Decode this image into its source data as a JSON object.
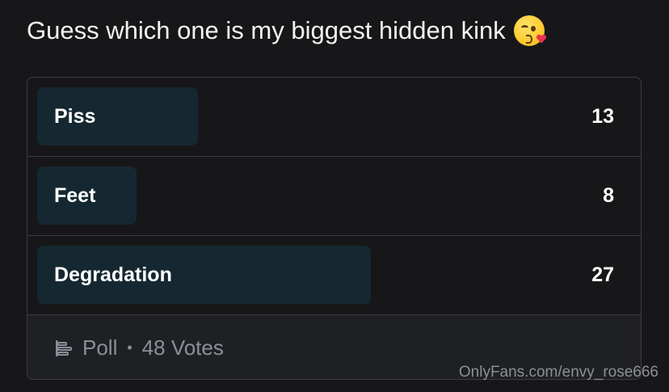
{
  "post": {
    "text": "Guess which one is my biggest hidden kink",
    "emoji_icon": "face-blowing-kiss-icon"
  },
  "poll": {
    "options": [
      {
        "label": "Piss",
        "votes": "13",
        "share": 0.271
      },
      {
        "label": "Feet",
        "votes": "8",
        "share": 0.167
      },
      {
        "label": "Degradation",
        "votes": "27",
        "share": 0.5625
      }
    ],
    "footer": {
      "icon": "poll-icon",
      "type_label": "Poll",
      "separator": "•",
      "votes_label": "48 Votes"
    },
    "colors": {
      "bar_fill": "#152831",
      "border": "#3a3d44",
      "footer_bg": "#1f2024"
    }
  },
  "watermark": "OnlyFans.com/envy_rose666"
}
